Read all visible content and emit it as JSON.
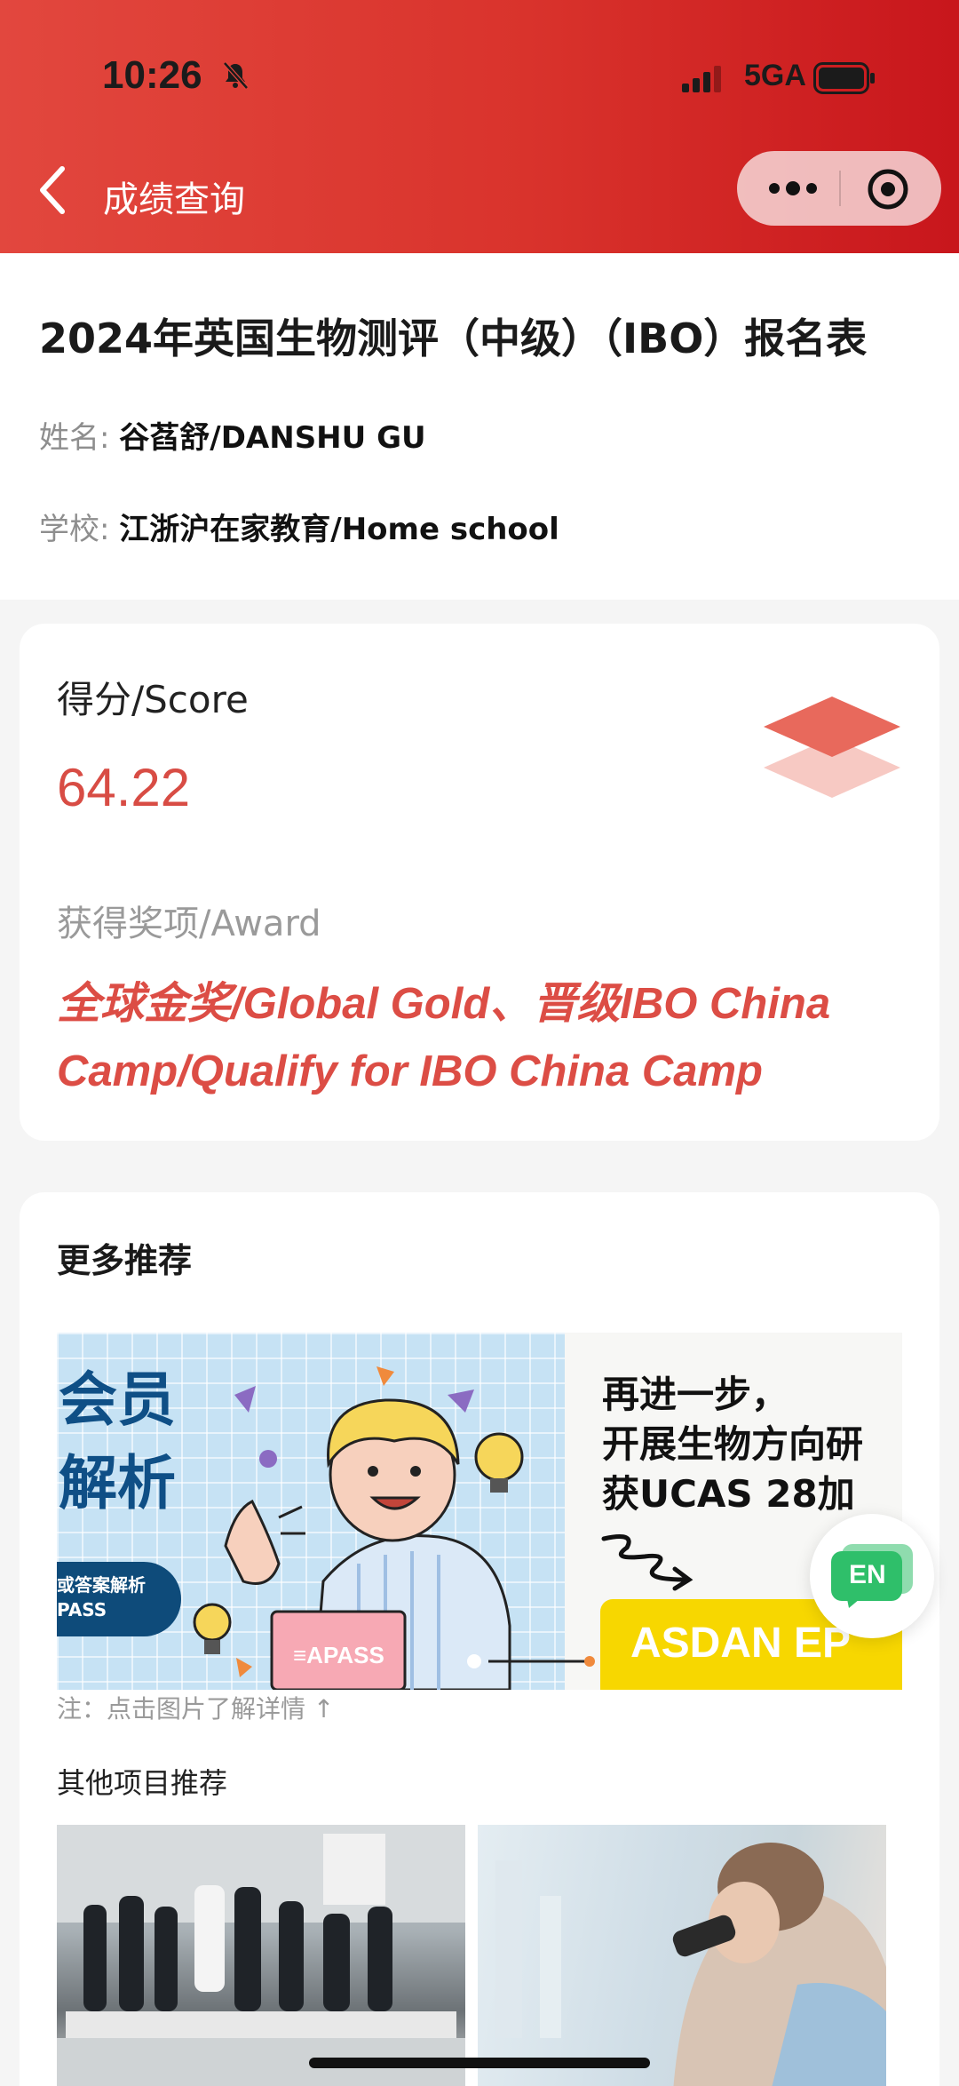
{
  "status_bar": {
    "time": "10:26",
    "network": "5GA"
  },
  "nav": {
    "title": "成绩查询"
  },
  "form": {
    "title": "2024年英国生物测评（中级）（IBO）报名表",
    "name_label": "姓名:",
    "name_value": "谷萏舒/DANSHU GU",
    "school_label": "学校:",
    "school_value": "江浙沪在家教育/Home school"
  },
  "score": {
    "label": "得分/Score",
    "value": "64.22",
    "award_label": "获得奖项/Award",
    "award_line1": "全球金奖/Global Gold、晋级IBO China",
    "award_line2": "Camp/Qualify for IBO China Camp"
  },
  "recommend": {
    "title": "更多推荐",
    "banner": {
      "left_line1": "会员",
      "left_line2": "解析",
      "pill_line1": "或答案解析",
      "pill_line2": "PASS",
      "laptop_brand": "≡APASS",
      "right_line1": "再进一步，",
      "right_line2": "开展生物方向研",
      "right_line3": "获UCAS 28加",
      "right_badge": "ASDAN EP"
    },
    "note": "注：点击图片了解详情 ↑",
    "other_title": "其他项目推荐"
  },
  "floating": {
    "label": "EN"
  },
  "colors": {
    "header_red": "#d9332c",
    "score_red": "#d84c44",
    "award_red": "#dc4d45",
    "badge_green": "#2fbf6a",
    "banner_yellow": "#f7d700"
  },
  "icons": [
    "bell-slash-icon",
    "signal-icon",
    "battery-icon",
    "back-chevron-icon",
    "more-dots-icon",
    "target-circle-icon",
    "layers-icon",
    "en-chat-icon"
  ]
}
